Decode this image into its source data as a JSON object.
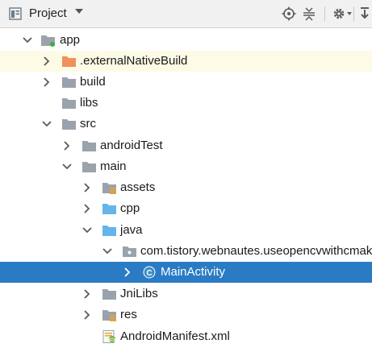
{
  "header": {
    "title": "Project",
    "icons": [
      "project-view-icon",
      "locate-icon",
      "collapse-all-icon",
      "settings-icon",
      "hide-panel-icon"
    ]
  },
  "colors": {
    "selection": "#2b7bc4",
    "highlight_row": "#fdfbe5",
    "folder_gray": "#9aa3ab",
    "folder_orange": "#f0905a",
    "folder_blue": "#64b5e8"
  },
  "tree": {
    "app": "app",
    "externalNativeBuild": ".externalNativeBuild",
    "build": "build",
    "libs": "libs",
    "src": "src",
    "androidTest": "androidTest",
    "main": "main",
    "assets": "assets",
    "cpp": "cpp",
    "java": "java",
    "package": "com.tistory.webnautes.useopencvwithcmak",
    "mainActivity": "MainActivity",
    "jniLibs": "JniLibs",
    "res": "res",
    "manifest": "AndroidManifest.xml"
  }
}
